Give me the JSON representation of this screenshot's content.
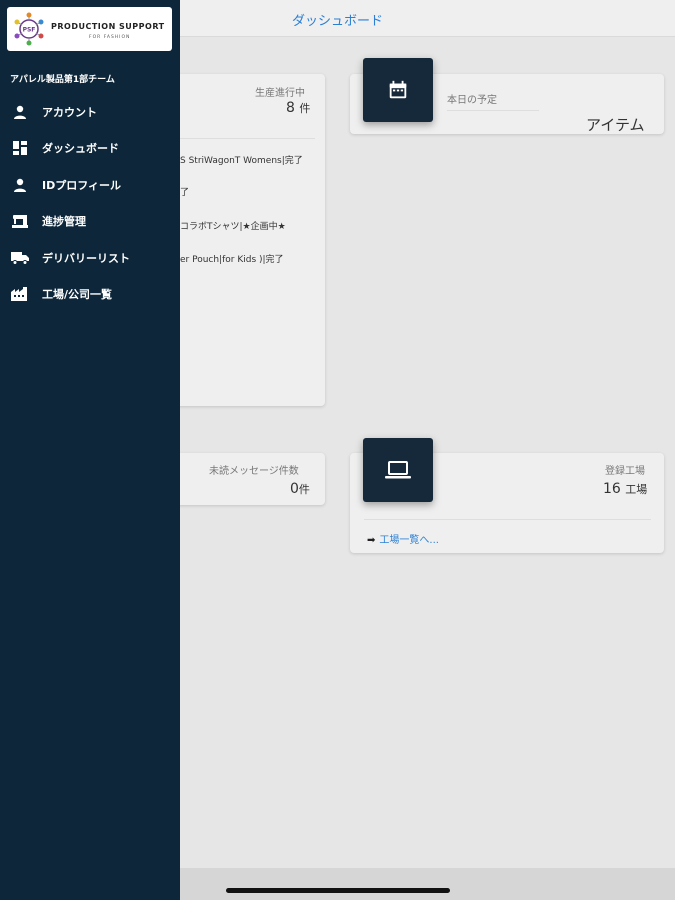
{
  "header": {
    "title": "ダッシュボード"
  },
  "cards": {
    "production": {
      "label": "生産進行中",
      "value": "8",
      "unit": "件",
      "items": [
        "S StriWagonT Womens|完了",
        "了",
        "コラボTシャツ|★企画中★",
        "er Pouch|for Kids )|完了"
      ]
    },
    "schedule": {
      "label": "本日の予定",
      "value": "アイテム",
      "icon": "calendar-icon"
    },
    "messages": {
      "label": "未読メッセージ件数",
      "value": "0",
      "unit": "件"
    },
    "factories": {
      "label": "登録工場",
      "value": "16",
      "unit": "工場",
      "icon": "laptop-icon",
      "link_label": "工場一覧へ...",
      "link_icon": "arrow-right-icon"
    }
  },
  "drawer": {
    "logo": {
      "title": "PRODUCTION SUPPORT",
      "subtitle": "FOR FASHION",
      "mark": "PSF"
    },
    "team": "アパレル製品第1部チーム",
    "items": [
      {
        "label": "アカウント",
        "icon": "person-icon"
      },
      {
        "label": "ダッシュボード",
        "icon": "dashboard-icon"
      },
      {
        "label": "IDプロフィール",
        "icon": "person-icon"
      },
      {
        "label": "進捗管理",
        "icon": "sewing-machine-icon"
      },
      {
        "label": "デリバリーリスト",
        "icon": "truck-icon"
      },
      {
        "label": "工場/公司一覧",
        "icon": "factory-icon"
      }
    ]
  },
  "colors": {
    "drawer": "#0d2639",
    "accent": "#2a7fd4",
    "icon_tile": "#16293b"
  }
}
